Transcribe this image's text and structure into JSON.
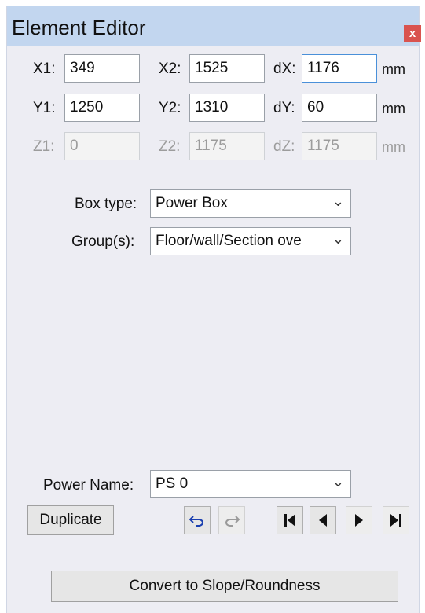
{
  "window": {
    "title": "Element Editor",
    "close_label": "x"
  },
  "coords": {
    "x1": {
      "label": "X1:",
      "value": "349"
    },
    "x2": {
      "label": "X2:",
      "value": "1525"
    },
    "dx": {
      "label": "dX:",
      "value": "1176"
    },
    "y1": {
      "label": "Y1:",
      "value": "1250"
    },
    "y2": {
      "label": "Y2:",
      "value": "1310"
    },
    "dy": {
      "label": "dY:",
      "value": "60"
    },
    "z1": {
      "label": "Z1:",
      "value": "0"
    },
    "z2": {
      "label": "Z2:",
      "value": "1175"
    },
    "dz": {
      "label": "dZ:",
      "value": "1175"
    },
    "unit": "mm"
  },
  "box_type": {
    "label": "Box type:",
    "value": "Power Box"
  },
  "groups": {
    "label": "Group(s):",
    "value": "Floor/wall/Section ove"
  },
  "power_name": {
    "label": "Power Name:",
    "value": "PS 0"
  },
  "buttons": {
    "duplicate": "Duplicate",
    "convert": "Convert to Slope/Roundness"
  },
  "icons": {
    "undo": "undo-icon",
    "redo": "redo-icon",
    "first": "first-icon",
    "prev": "previous-icon",
    "next": "next-icon",
    "last": "last-icon"
  },
  "colors": {
    "titlebar": "#c2d6ef",
    "close": "#d9534f",
    "panel": "#ededf3",
    "focus": "#4a90d9"
  }
}
